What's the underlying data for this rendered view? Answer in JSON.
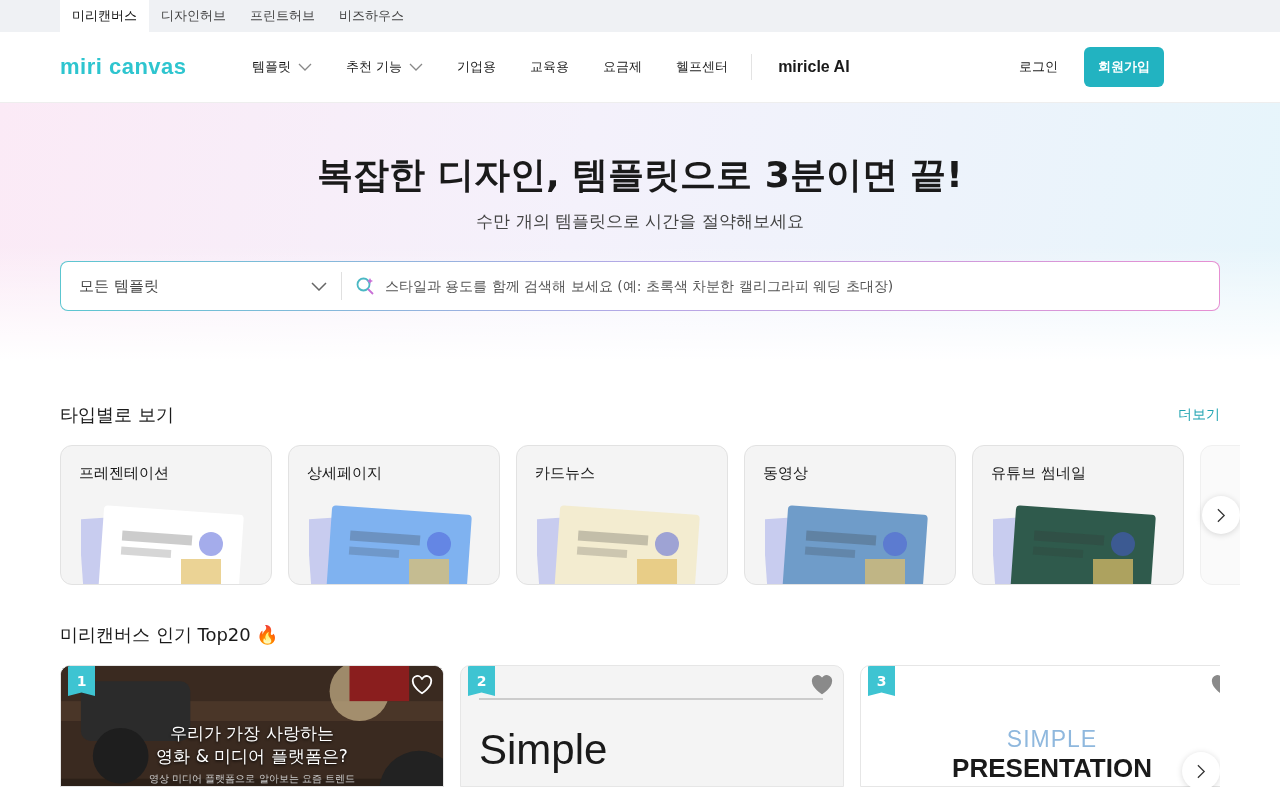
{
  "site_tabs": [
    {
      "label": "미리캔버스",
      "selected": true
    },
    {
      "label": "디자인허브",
      "selected": false
    },
    {
      "label": "프린트허브",
      "selected": false
    },
    {
      "label": "비즈하우스",
      "selected": false
    }
  ],
  "header": {
    "logo": "miri canvas",
    "nav": [
      {
        "label": "템플릿",
        "dropdown": true
      },
      {
        "label": "추천 기능",
        "dropdown": true
      },
      {
        "label": "기업용",
        "dropdown": false
      },
      {
        "label": "교육용",
        "dropdown": false
      },
      {
        "label": "요금제",
        "dropdown": false
      },
      {
        "label": "헬프센터",
        "dropdown": false
      }
    ],
    "ai_link": "miricle AI",
    "login": "로그인",
    "signup": "회원가입"
  },
  "hero": {
    "title": "복잡한 디자인, 템플릿으로 3분이면 끝!",
    "subtitle": "수만 개의 템플릿으로 시간을 절약해보세요",
    "category": "모든 템플릿",
    "search_placeholder": "스타일과 용도를 함께 검색해 보세요 (예: 초록색 차분한 캘리그라피 웨딩 초대장)"
  },
  "type_section": {
    "title": "타입별로 보기",
    "more": "더보기",
    "cards": [
      {
        "label": "프레젠테이션",
        "color": "#ffffff"
      },
      {
        "label": "상세페이지",
        "color": "#7fb2f0"
      },
      {
        "label": "카드뉴스",
        "color": "#f3ecd0"
      },
      {
        "label": "동영상",
        "color": "#6f9cc9"
      },
      {
        "label": "유튜브 썸네일",
        "color": "#2f5a4c"
      }
    ]
  },
  "top_section": {
    "title": "미리캔버스 인기 Top20",
    "emoji": "🔥",
    "cards": [
      {
        "rank": "1",
        "liked": false,
        "lines": [
          "우리가 가장 사랑하는",
          "영화 & 미디어 플랫폼은?"
        ],
        "caption": "영상 미디어 플랫폼으로 알아보는 요즘 트렌드"
      },
      {
        "rank": "2",
        "kind": "simple",
        "liked": true,
        "lines": [
          "Simple"
        ]
      },
      {
        "rank": "3",
        "kind": "presentation",
        "liked": true,
        "lines": [
          "SIMPLE",
          "PRESENTATION"
        ]
      }
    ]
  }
}
